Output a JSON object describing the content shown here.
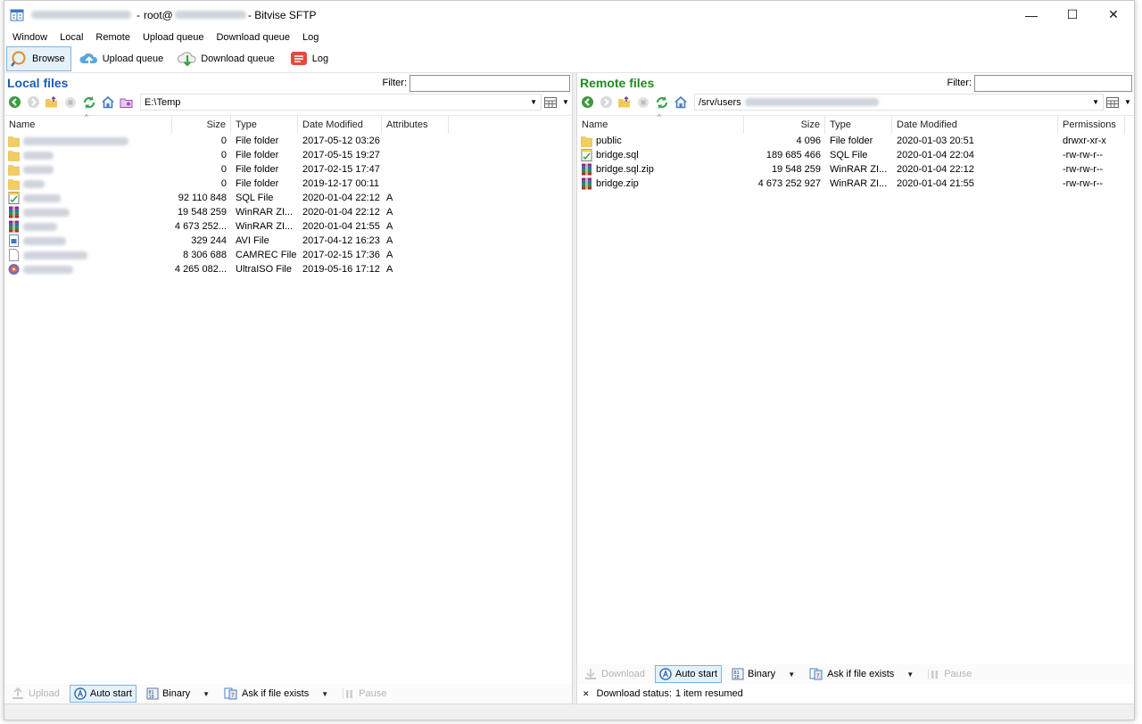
{
  "window": {
    "title_prefix": "root@",
    "title_suffix": " - Bitvise SFTP",
    "minimize": "—",
    "maximize": "☐",
    "close": "✕"
  },
  "menu": [
    "Window",
    "Local",
    "Remote",
    "Upload queue",
    "Download queue",
    "Log"
  ],
  "toolbar": {
    "browse": "Browse",
    "upload_queue": "Upload queue",
    "download_queue": "Download queue",
    "log": "Log"
  },
  "local": {
    "title": "Local files",
    "filter_label": "Filter:",
    "path": "E:\\Temp",
    "columns": {
      "name": "Name",
      "size": "Size",
      "type": "Type",
      "date": "Date Modified",
      "extra": "Attributes"
    },
    "rows": [
      {
        "icon": "folder",
        "size": "0",
        "type": "File folder",
        "date": "2017-05-12 03:26",
        "extra": ""
      },
      {
        "icon": "folder",
        "size": "0",
        "type": "File folder",
        "date": "2017-05-15 19:27",
        "extra": ""
      },
      {
        "icon": "folder",
        "size": "0",
        "type": "File folder",
        "date": "2017-02-15 17:47",
        "extra": ""
      },
      {
        "icon": "folder",
        "size": "0",
        "type": "File folder",
        "date": "2019-12-17 00:11",
        "extra": ""
      },
      {
        "icon": "sql",
        "size": "92 110 848",
        "type": "SQL File",
        "date": "2020-01-04 22:12",
        "extra": "A"
      },
      {
        "icon": "rar",
        "size": "19 548 259",
        "type": "WinRAR ZI...",
        "date": "2020-01-04 22:12",
        "extra": "A"
      },
      {
        "icon": "rar",
        "size": "4 673 252...",
        "type": "WinRAR ZI...",
        "date": "2020-01-04 21:55",
        "extra": "A"
      },
      {
        "icon": "avi",
        "size": "329 244",
        "type": "AVI File",
        "date": "2017-04-12 16:23",
        "extra": "A"
      },
      {
        "icon": "file",
        "size": "8 306 688",
        "type": "CAMREC File",
        "date": "2017-02-15 17:36",
        "extra": "A"
      },
      {
        "icon": "iso",
        "size": "4 265 082...",
        "type": "UltraISO File",
        "date": "2019-05-16 17:12",
        "extra": "A"
      }
    ],
    "transfer": {
      "upload": "Upload",
      "auto_start": "Auto start",
      "binary": "Binary",
      "ask": "Ask if file exists",
      "pause": "Pause"
    }
  },
  "remote": {
    "title": "Remote files",
    "filter_label": "Filter:",
    "path": "/srv/users",
    "columns": {
      "name": "Name",
      "size": "Size",
      "type": "Type",
      "date": "Date Modified",
      "extra": "Permissions"
    },
    "rows": [
      {
        "icon": "folder",
        "name": "public",
        "size": "4 096",
        "type": "File folder",
        "date": "2020-01-03 20:51",
        "extra": "drwxr-xr-x"
      },
      {
        "icon": "sql",
        "name": "bridge.sql",
        "size": "189 685 466",
        "type": "SQL File",
        "date": "2020-01-04 22:04",
        "extra": "-rw-rw-r--"
      },
      {
        "icon": "rar",
        "name": "bridge.sql.zip",
        "size": "19 548 259",
        "type": "WinRAR ZI...",
        "date": "2020-01-04 22:12",
        "extra": "-rw-rw-r--"
      },
      {
        "icon": "rar",
        "name": "bridge.zip",
        "size": "4 673 252 927",
        "type": "WinRAR ZI...",
        "date": "2020-01-04 21:55",
        "extra": "-rw-rw-r--"
      }
    ],
    "transfer": {
      "download": "Download",
      "auto_start": "Auto start",
      "binary": "Binary",
      "ask": "Ask if file exists",
      "pause": "Pause"
    },
    "status_label": "Download status:",
    "status_value": "1 item resumed",
    "status_close": "✕"
  }
}
